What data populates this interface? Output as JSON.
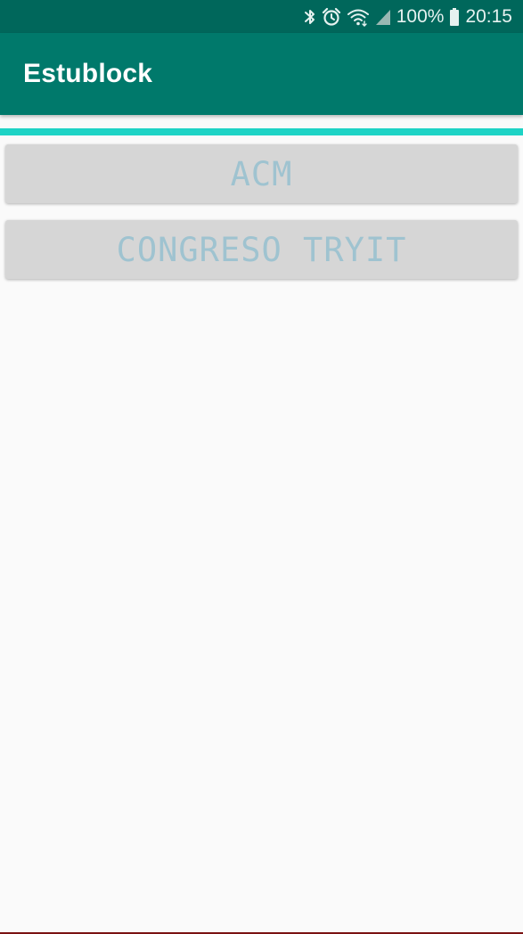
{
  "status_bar": {
    "icons": [
      "bluetooth-icon",
      "alarm-icon",
      "wifi-icon",
      "signal-icon",
      "battery-icon"
    ],
    "battery_percent": "100%",
    "time": "20:15"
  },
  "app_bar": {
    "title": "Estublock"
  },
  "buttons": [
    {
      "label": "ACM"
    },
    {
      "label": "CONGRESO TRYIT"
    }
  ],
  "colors": {
    "status_bar": "#00675b",
    "app_bar": "#00796b",
    "accent": "#1dd3c5",
    "button_bg": "#d6d6d6",
    "button_text": "#9fc3d0",
    "background": "#fafafa"
  }
}
